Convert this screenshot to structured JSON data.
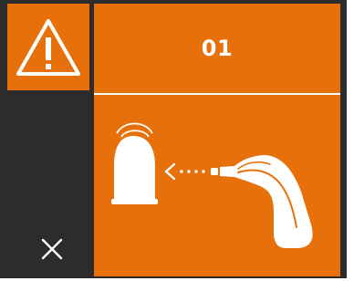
{
  "status": {
    "icon": "warning-triangle-icon",
    "code": "01"
  },
  "controls": {
    "close_icon": "close-x-icon"
  },
  "illustration": {
    "icons": [
      "ear-probe-cover-icon",
      "arrow-left-dotted-icon",
      "ear-thermometer-icon"
    ]
  },
  "colors": {
    "accent": "#e8700a",
    "background": "#2c2c2c",
    "foreground": "#ffffff"
  }
}
